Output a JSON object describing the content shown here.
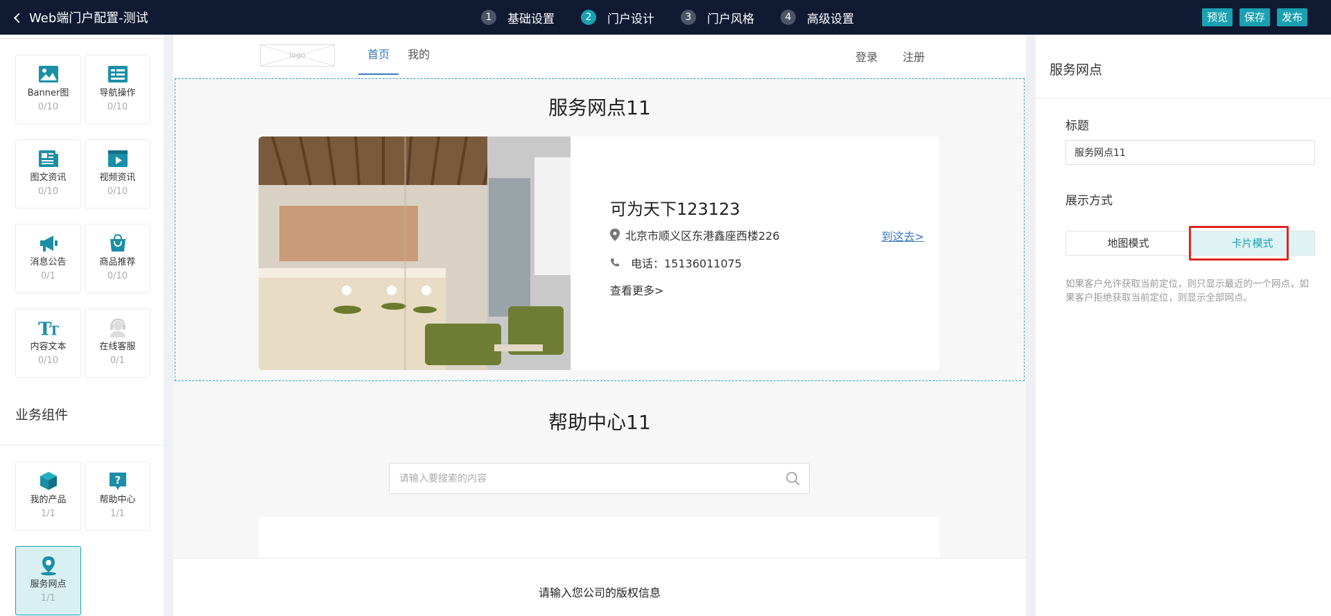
{
  "topbar": {
    "back_label": "Web端门户配置-测试",
    "steps": [
      {
        "num": "1",
        "label": "基础设置"
      },
      {
        "num": "2",
        "label": "门户设计"
      },
      {
        "num": "3",
        "label": "门户风格"
      },
      {
        "num": "4",
        "label": "高级设置"
      }
    ],
    "active_step": 2,
    "actions": {
      "preview": "预览",
      "save": "保存",
      "publish": "发布"
    }
  },
  "sidebar": {
    "basic_components": [
      {
        "name": "Banner图",
        "count": "0/10",
        "icon": "image-icon"
      },
      {
        "name": "导航操作",
        "count": "0/10",
        "icon": "nav-menu-icon"
      },
      {
        "name": "图文资讯",
        "count": "0/10",
        "icon": "article-icon"
      },
      {
        "name": "视频资讯",
        "count": "0/10",
        "icon": "video-icon"
      },
      {
        "name": "消息公告",
        "count": "0/1",
        "icon": "megaphone-icon"
      },
      {
        "name": "商品推荐",
        "count": "0/10",
        "icon": "shopping-bag-icon"
      },
      {
        "name": "内容文本",
        "count": "0/10",
        "icon": "text-icon"
      },
      {
        "name": "在线客服",
        "count": "0/1",
        "icon": "customer-service-icon"
      }
    ],
    "business_title": "业务组件",
    "business_components": [
      {
        "name": "我的产品",
        "count": "1/1",
        "icon": "box-icon"
      },
      {
        "name": "帮助中心",
        "count": "1/1",
        "icon": "help-icon"
      },
      {
        "name": "服务网点",
        "count": "1/1",
        "icon": "location-pin-icon"
      }
    ]
  },
  "preview": {
    "logo_text": "logo",
    "nav": [
      "首页",
      "我的"
    ],
    "auth": {
      "login": "登录",
      "register": "注册"
    },
    "service": {
      "title": "服务网点11",
      "card": {
        "name": "可为天下123123",
        "address": "北京市顺义区东港鑫座西楼226",
        "goto": "到这去>",
        "phone": "电话：15136011075",
        "more": "查看更多>"
      }
    },
    "help": {
      "title": "帮助中心11",
      "search_placeholder": "请输入要搜索的内容"
    },
    "footer": "请输入您公司的版权信息"
  },
  "panel": {
    "title": "服务网点",
    "title_label": "标题",
    "title_value": "服务网点11",
    "display_label": "展示方式",
    "modes": [
      "地图模式",
      "卡片模式"
    ],
    "active_mode": 1,
    "hint": "如果客户允许获取当前定位，则只显示最近的一个网点，如果客户拒绝获取当前定位，则显示全部网点。"
  },
  "colors": {
    "topbar": "#101a33",
    "accent": "#1aa1b1",
    "link": "#3a78c3",
    "highlight": "#e0231f"
  }
}
